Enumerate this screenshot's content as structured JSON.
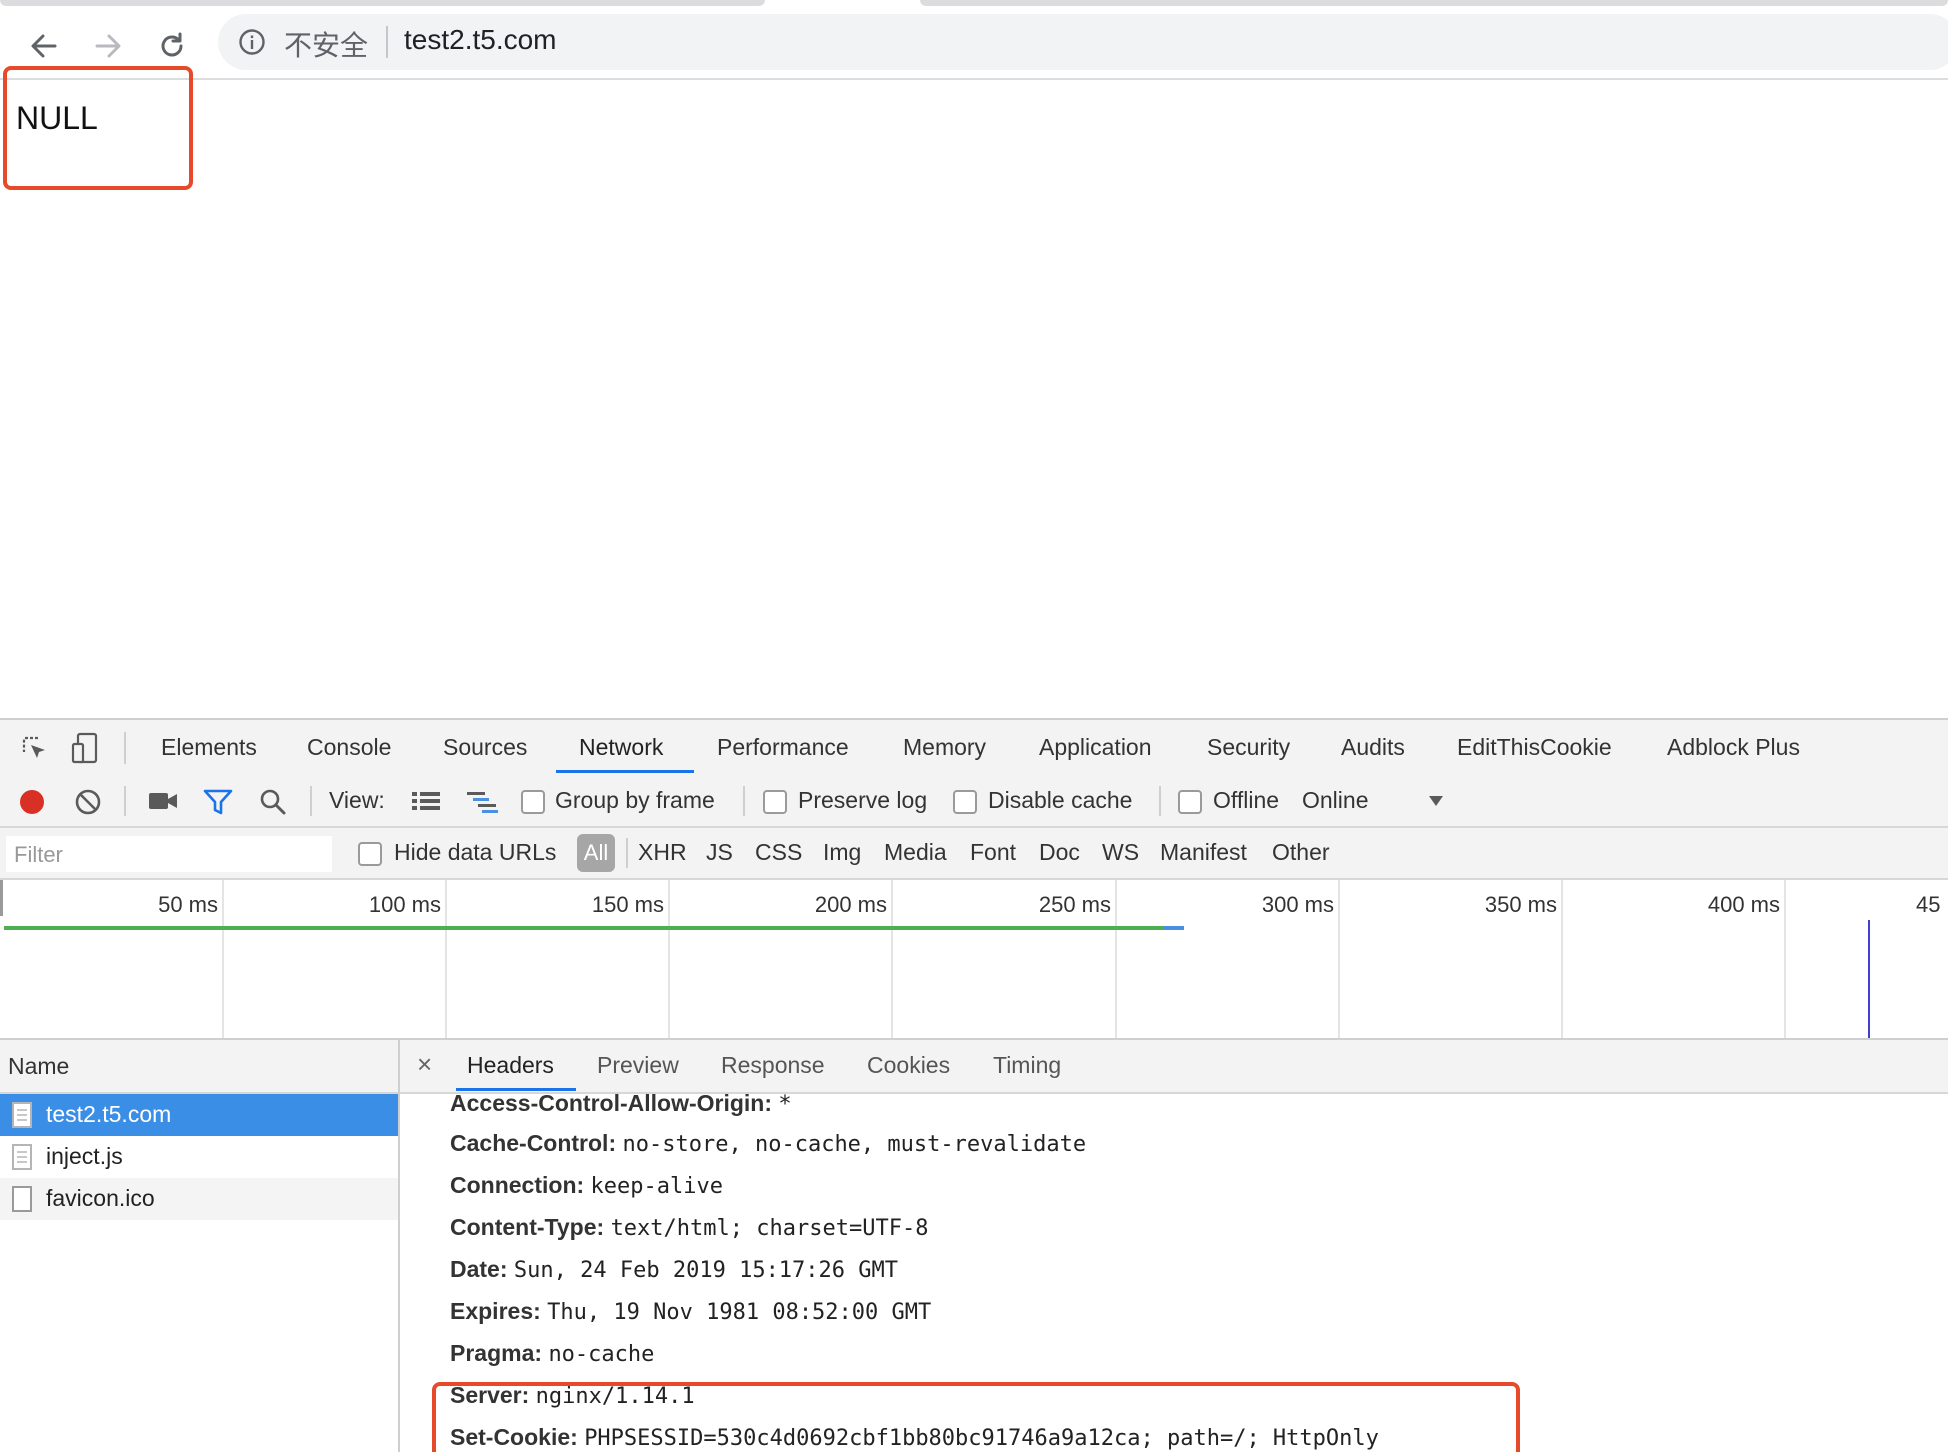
{
  "browser": {
    "security_label": "不安全",
    "url": "test2.t5.com"
  },
  "page": {
    "content_text": "NULL"
  },
  "devtools": {
    "tabs": [
      {
        "label": "Elements"
      },
      {
        "label": "Console"
      },
      {
        "label": "Sources"
      },
      {
        "label": "Network"
      },
      {
        "label": "Performance"
      },
      {
        "label": "Memory"
      },
      {
        "label": "Application"
      },
      {
        "label": "Security"
      },
      {
        "label": "Audits"
      },
      {
        "label": "EditThisCookie"
      },
      {
        "label": "Adblock Plus"
      }
    ],
    "active_tab": "Network",
    "network_toolbar": {
      "view_label": "View:",
      "group_by_frame": "Group by frame",
      "preserve_log": "Preserve log",
      "disable_cache": "Disable cache",
      "offline": "Offline",
      "throttle_value": "Online"
    },
    "filter_bar": {
      "placeholder": "Filter",
      "hide_data_urls": "Hide data URLs",
      "types": [
        "All",
        "XHR",
        "JS",
        "CSS",
        "Img",
        "Media",
        "Font",
        "Doc",
        "WS",
        "Manifest",
        "Other"
      ],
      "active_type": "All"
    },
    "timeline": {
      "tick_labels": [
        "50 ms",
        "100 ms",
        "150 ms",
        "200 ms",
        "250 ms",
        "300 ms",
        "350 ms",
        "400 ms",
        "45"
      ],
      "colors": {
        "loaded": "#4caf50",
        "waiting": "#4a90e2",
        "load_marker": "#4040d0"
      }
    },
    "request_list": {
      "column_name": "Name",
      "items": [
        {
          "name": "test2.t5.com",
          "selected": true
        },
        {
          "name": "inject.js",
          "selected": false
        },
        {
          "name": "favicon.ico",
          "selected": false
        }
      ]
    },
    "detail": {
      "close_symbol": "×",
      "tabs": [
        "Headers",
        "Preview",
        "Response",
        "Cookies",
        "Timing"
      ],
      "active_tab": "Headers",
      "headers": [
        {
          "key": "Access-Control-Allow-Origin:",
          "value": "*"
        },
        {
          "key": "Cache-Control:",
          "value": "no-store, no-cache, must-revalidate"
        },
        {
          "key": "Connection:",
          "value": "keep-alive"
        },
        {
          "key": "Content-Type:",
          "value": "text/html; charset=UTF-8"
        },
        {
          "key": "Date:",
          "value": "Sun, 24 Feb 2019 15:17:26 GMT"
        },
        {
          "key": "Expires:",
          "value": "Thu, 19 Nov 1981 08:52:00 GMT"
        },
        {
          "key": "Pragma:",
          "value": "no-cache"
        },
        {
          "key": "Server:",
          "value": "nginx/1.14.1"
        },
        {
          "key": "Set-Cookie:",
          "value": "PHPSESSID=530c4d0692cbf1bb80bc91746a9a12ca; path=/; HttpOnly"
        }
      ]
    }
  },
  "colors": {
    "annotation": "#e64a2b",
    "selected_row": "#3b8ee6",
    "record_button": "#d93025",
    "accent": "#1a73e8"
  }
}
